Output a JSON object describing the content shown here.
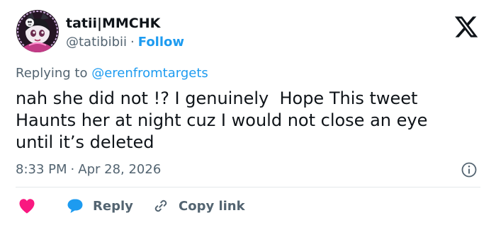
{
  "author": {
    "display_name": "tatii|MMCHK",
    "handle": "@tatibibii",
    "separator": "·",
    "follow_label": "Follow"
  },
  "reply_context": {
    "prefix": "Replying to",
    "mention": "@erenfromtargets"
  },
  "tweet": {
    "lines": [
      "nah she did not !? I genuinely  Hope This tweet",
      "Haunts her at night cuz I would not close an eye",
      "until it’s deleted"
    ]
  },
  "meta": {
    "time": "8:33 PM",
    "separator": "·",
    "date": "Apr 28, 2026"
  },
  "actions": {
    "reply_label": "Reply",
    "copy_link_label": "Copy link"
  },
  "icons": {
    "logo": "x-logo-icon",
    "info": "info-icon",
    "like": "heart-icon",
    "reply": "speech-bubble-icon",
    "copy": "link-icon"
  },
  "colors": {
    "accent": "#1d9bf0",
    "like": "#f91880",
    "text": "#0f1419",
    "secondary": "#536471",
    "divider": "#e5e8eb"
  }
}
